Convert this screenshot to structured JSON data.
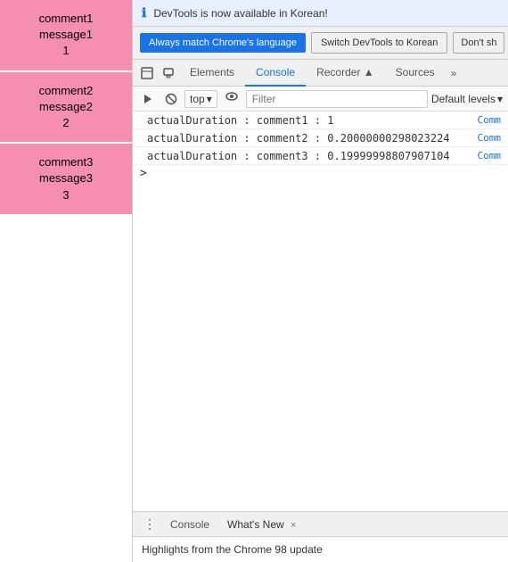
{
  "left_panel": {
    "items": [
      {
        "label": "comment1\nmessage1\n1"
      },
      {
        "label": "comment2\nmessage2\n2"
      },
      {
        "label": "comment3\nmessage3\n3"
      }
    ]
  },
  "devtools": {
    "info_bar": {
      "icon": "ℹ",
      "text": "DevTools is now available in Korean!"
    },
    "buttons": {
      "match_language": "Always match Chrome's language",
      "switch_korean": "Switch DevTools to Korean",
      "dont_show": "Don't sh"
    },
    "tabs": {
      "items": [
        "Elements",
        "Console",
        "Recorder ▲",
        "Sources",
        "»"
      ],
      "active": "Console",
      "icons": [
        "cursor",
        "box"
      ]
    },
    "toolbar": {
      "top_label": "top",
      "filter_placeholder": "Filter",
      "default_levels": "Default levels"
    },
    "console_lines": [
      {
        "text": "actualDuration : comment1 : 1",
        "link": "Comm"
      },
      {
        "text": "actualDuration : comment2 : 0.20000000298023224",
        "link": "Comm"
      },
      {
        "text": "actualDuration : comment3 : 0.19999998807907104",
        "link": "Comm"
      }
    ],
    "bottom_tabs": [
      {
        "label": "Console",
        "closeable": false,
        "active": false
      },
      {
        "label": "What's New",
        "closeable": true,
        "active": true
      }
    ],
    "bottom_status": "Highlights from the Chrome 98 update",
    "bottom_menu_icon": "⋮"
  }
}
